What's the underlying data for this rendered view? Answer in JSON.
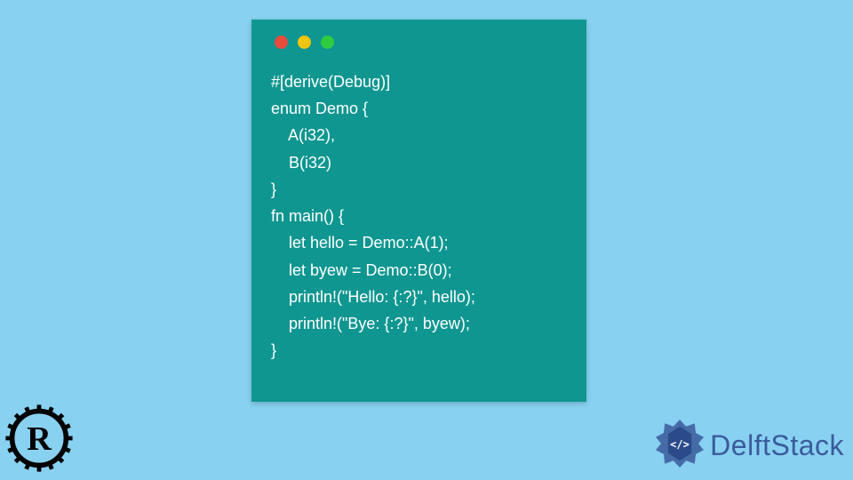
{
  "window": {
    "bg": "#0f9690",
    "dots": [
      "red",
      "yellow",
      "green"
    ]
  },
  "code": {
    "lines": [
      "#[derive(Debug)]",
      "enum Demo {",
      "    A(i32),",
      "    B(i32)",
      "}",
      "fn main() {",
      "    let hello = Demo::A(1);",
      "    let byew = Demo::B(0);",
      "    println!(\"Hello: {:?}\", hello);",
      "    println!(\"Bye: {:?}\", byew);",
      "}"
    ]
  },
  "branding": {
    "delft_text": "DelftStack"
  }
}
